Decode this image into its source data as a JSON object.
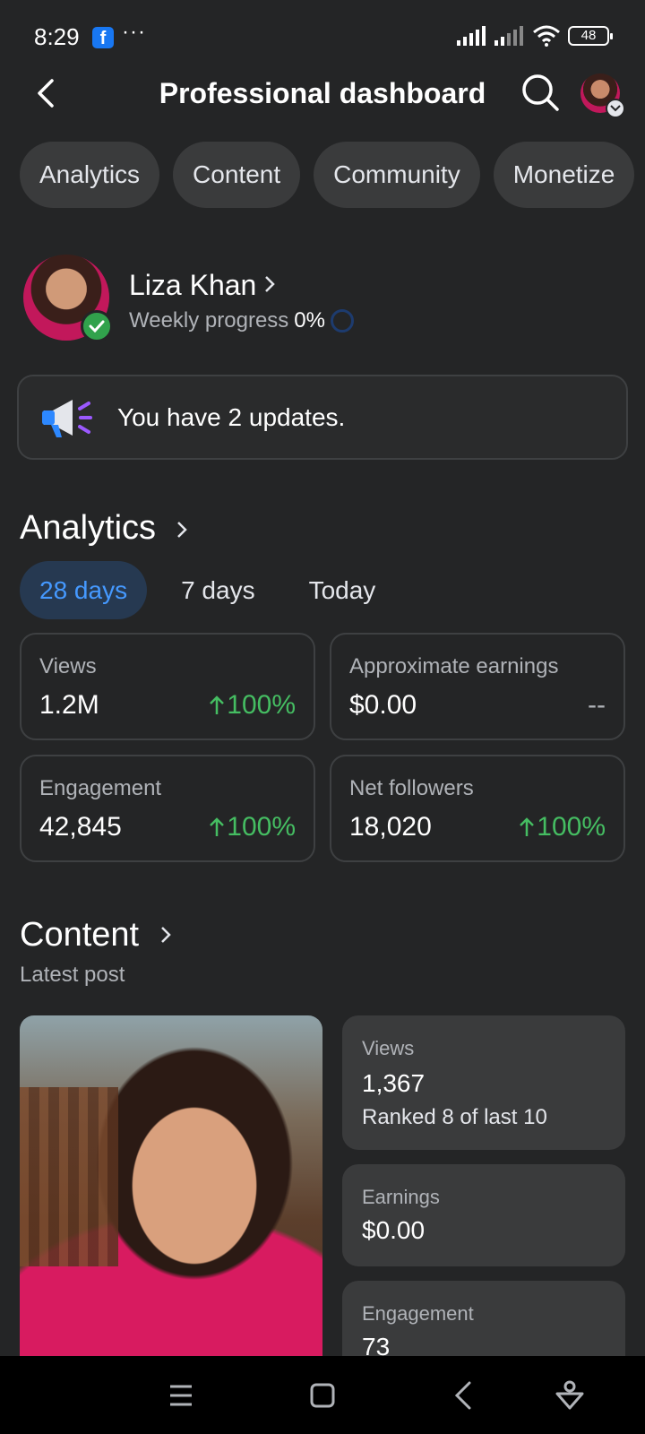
{
  "status_bar": {
    "time": "8:29",
    "app_badge": "f",
    "more_dots": "···",
    "battery": "48"
  },
  "header": {
    "title": "Professional dashboard"
  },
  "chips": [
    "Analytics",
    "Content",
    "Community",
    "Monetize"
  ],
  "profile": {
    "name": "Liza Khan",
    "progress_label": "Weekly progress",
    "progress_value": "0%"
  },
  "updates": {
    "text": "You have 2 updates."
  },
  "analytics": {
    "title": "Analytics",
    "ranges": [
      "28 days",
      "7 days",
      "Today"
    ],
    "active_range": "28 days",
    "metrics": [
      {
        "label": "Views",
        "value": "1.2M",
        "change": "100%",
        "trend": "up"
      },
      {
        "label": "Approximate earnings",
        "value": "$0.00",
        "change": "--",
        "trend": "none"
      },
      {
        "label": "Engagement",
        "value": "42,845",
        "change": "100%",
        "trend": "up"
      },
      {
        "label": "Net followers",
        "value": "18,020",
        "change": "100%",
        "trend": "up"
      }
    ]
  },
  "content": {
    "title": "Content",
    "subtitle": "Latest post",
    "post_stats": {
      "views_label": "Views",
      "views_value": "1,367",
      "views_rank": "Ranked 8 of last 10",
      "earnings_label": "Earnings",
      "earnings_value": "$0.00",
      "engagement_label": "Engagement",
      "engagement_value": "73"
    }
  },
  "colors": {
    "background": "#242526",
    "accent": "#4599ff",
    "positive": "#45bd62",
    "card": "#3a3b3c"
  }
}
